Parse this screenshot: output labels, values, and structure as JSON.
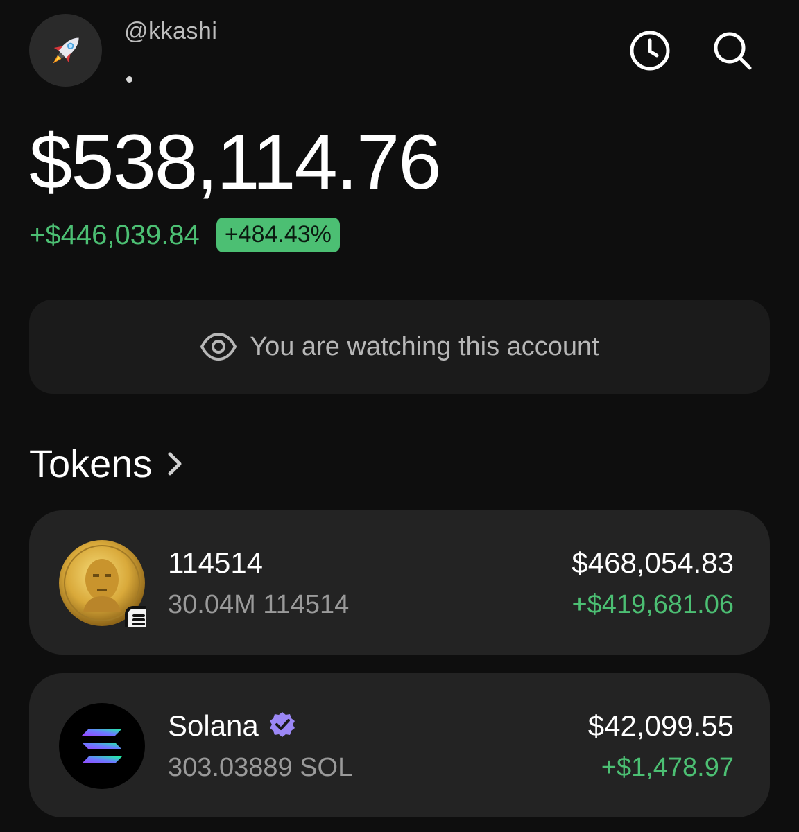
{
  "header": {
    "username": "@kkashi",
    "avatar_icon": "rocket-icon",
    "history_icon": "clock-icon",
    "search_icon": "search-icon"
  },
  "portfolio": {
    "balance": "$538,114.76",
    "change_amount": "+$446,039.84",
    "change_percent": "+484.43%"
  },
  "watch_banner": {
    "icon": "eye-icon",
    "text": "You are watching this account"
  },
  "tokens_section": {
    "title": "Tokens",
    "icon": "chevron-right-icon"
  },
  "tokens": [
    {
      "name": "114514",
      "amount": "30.04M 114514",
      "value": "$468,054.83",
      "gain": "+$419,681.06",
      "icon": "coin-icon",
      "badge_icon": "solana-badge-icon"
    },
    {
      "name": "Solana",
      "amount": "303.03889 SOL",
      "value": "$42,099.55",
      "gain": "+$1,478.97",
      "icon": "solana-icon",
      "verified_icon": "verified-badge-icon"
    }
  ],
  "colors": {
    "background": "#0e0e0e",
    "card": "#232323",
    "positive": "#4cbf73",
    "verified": "#9b87f5"
  }
}
